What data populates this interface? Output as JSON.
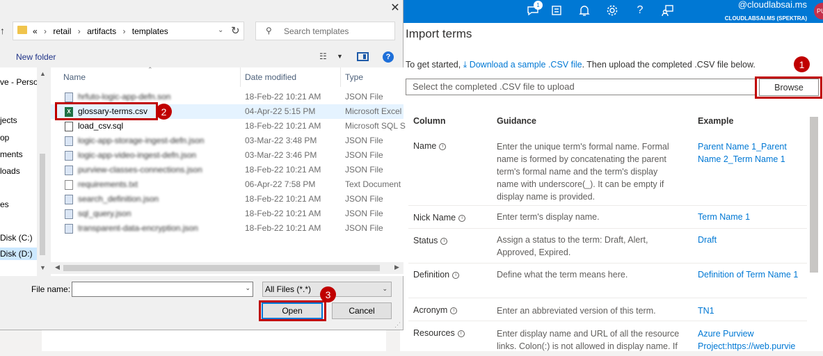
{
  "azure": {
    "notification_count": "1",
    "user_email": "@cloudlabsai.ms",
    "directory": "CLOUDLABSAI.MS (SPEKTRA)",
    "avatar_initials": "PU",
    "icons": [
      "feedback-icon",
      "directory-icon",
      "bell-icon",
      "gear-icon",
      "help-icon",
      "person-feedback-icon"
    ]
  },
  "import_panel": {
    "title": "Import terms",
    "intro_prefix": "To get started, ",
    "download_link": "Download a sample .CSV file",
    "intro_suffix": ". Then upload the completed .CSV file below.",
    "file_placeholder": "Select the completed .CSV file to upload",
    "browse_label": "Browse",
    "columns": [
      "Column",
      "Guidance",
      "Example"
    ],
    "rows": [
      {
        "column": "Name",
        "guidance": "Enter the unique term's formal name. Formal name is formed by concatenating the parent term's formal name and the term's display name with underscore(_). It can be empty if display name is provided.",
        "example": "Parent Name 1_Parent Name 2_Term Name 1"
      },
      {
        "column": "Nick Name",
        "guidance": "Enter term's display name.",
        "example": "Term Name 1"
      },
      {
        "column": "Status",
        "guidance": "Assign a status to the term: Draft, Alert, Approved, Expired.",
        "example": "Draft"
      },
      {
        "column": "Definition",
        "guidance": "Define what the term means here.",
        "example": "Definition of Term Name 1"
      },
      {
        "column": "Acronym",
        "guidance": "Enter an abbreviated version of this term.",
        "example": "TN1"
      },
      {
        "column": "Resources",
        "guidance": "Enter display name and URL of all the resource links. Colon(:) is not allowed in display name. If",
        "example": "Azure Purview Project:https://web.purvie"
      }
    ]
  },
  "dialog": {
    "address": {
      "prefix": "«",
      "crumbs": [
        "retail",
        "artifacts",
        "templates"
      ]
    },
    "search_placeholder": "Search templates",
    "new_folder": "New folder",
    "nav_items": [
      "ve - Persor",
      "jects",
      "op",
      "ments",
      "loads",
      "es",
      "Disk (C:)",
      "Disk (D:)"
    ],
    "columns": {
      "name": "Name",
      "date": "Date modified",
      "type": "Type"
    },
    "files": [
      {
        "name": "hrfuto-logic-app-defn.son",
        "date": "18-Feb-22 10:21 AM",
        "type": "JSON File",
        "icon": "json",
        "blur": true
      },
      {
        "name": "glossary-terms.csv",
        "date": "04-Apr-22 5:15 PM",
        "type": "Microsoft Excel",
        "icon": "xls",
        "blur": false
      },
      {
        "name": "load_csv.sql",
        "date": "18-Feb-22 10:21 AM",
        "type": "Microsoft SQL S",
        "icon": "sql",
        "blur": false
      },
      {
        "name": "logic-app-storage-ingest-defn.json",
        "date": "03-Mar-22 3:48 PM",
        "type": "JSON File",
        "icon": "json",
        "blur": true
      },
      {
        "name": "logic-app-video-ingest-defn.json",
        "date": "03-Mar-22 3:46 PM",
        "type": "JSON File",
        "icon": "json",
        "blur": true
      },
      {
        "name": "purview-classes-connections.json",
        "date": "18-Feb-22 10:21 AM",
        "type": "JSON File",
        "icon": "json",
        "blur": true
      },
      {
        "name": "requirements.txt",
        "date": "06-Apr-22 7:58 PM",
        "type": "Text Document",
        "icon": "txt",
        "blur": true
      },
      {
        "name": "search_definition.json",
        "date": "18-Feb-22 10:21 AM",
        "type": "JSON File",
        "icon": "json",
        "blur": true
      },
      {
        "name": "sql_query.json",
        "date": "18-Feb-22 10:21 AM",
        "type": "JSON File",
        "icon": "json",
        "blur": true
      },
      {
        "name": "transparent-data-encryption.json",
        "date": "18-Feb-22 10:21 AM",
        "type": "JSON File",
        "icon": "json",
        "blur": true
      }
    ],
    "file_name_label": "File name:",
    "file_name_value": "",
    "filter_value": "All Files (*.*)",
    "open_label": "Open",
    "cancel_label": "Cancel"
  },
  "callouts": [
    "1",
    "2",
    "3"
  ],
  "colors": {
    "azure_blue": "#0078d4",
    "highlight_red": "#c00000",
    "selection_blue": "#cce8ff"
  }
}
